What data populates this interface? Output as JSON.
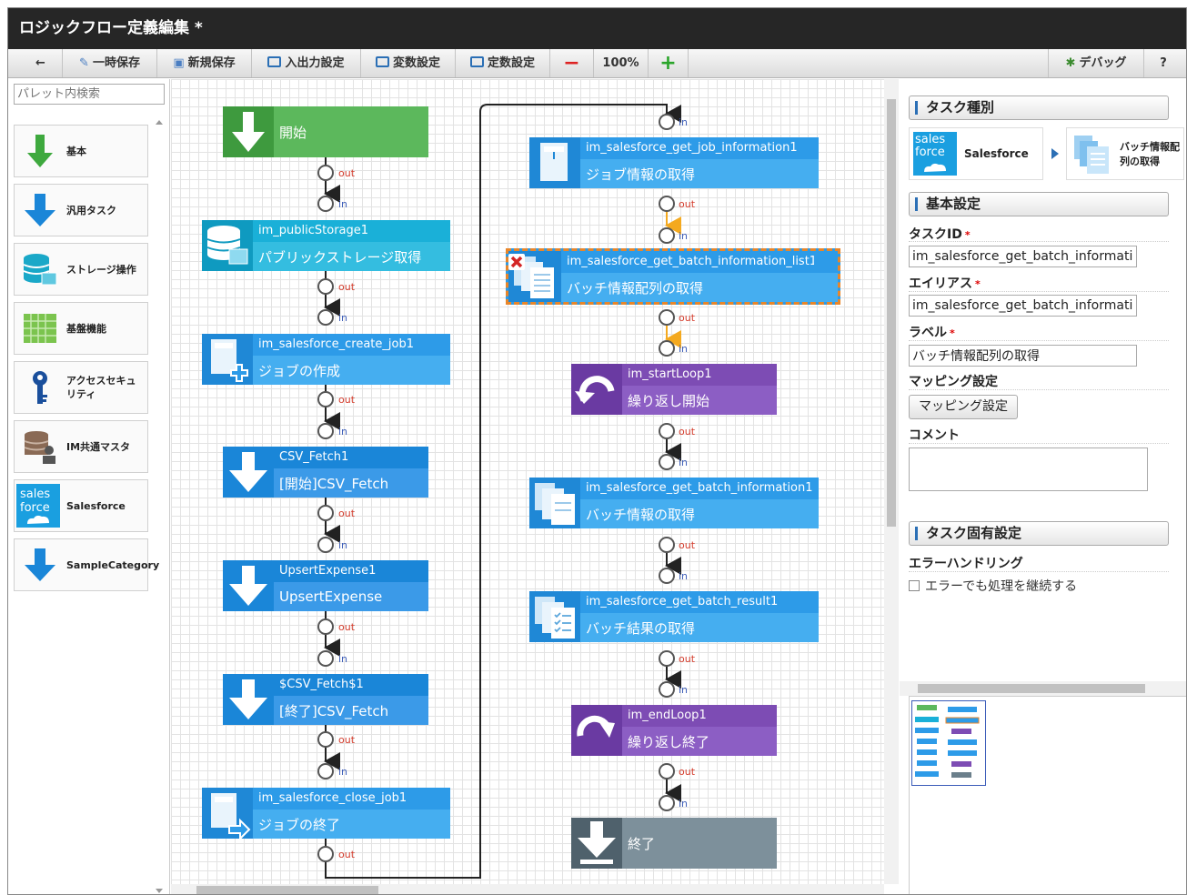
{
  "window": {
    "title": "ロジックフロー定義編集  *"
  },
  "toolbar": {
    "back": "←",
    "temp_save": "一時保存",
    "new_save": "新規保存",
    "io_settings": "入出力設定",
    "var_settings": "変数設定",
    "const_settings": "定数設定",
    "zoom_out": "−",
    "zoom_level": "100%",
    "zoom_in": "+",
    "debug": "デバッグ",
    "help": "?"
  },
  "palette": {
    "search_placeholder": "パレット内検索",
    "items": [
      {
        "label": "基本",
        "icon": "arrow-down-green-icon"
      },
      {
        "label": "汎用タスク",
        "icon": "arrow-down-blue-icon"
      },
      {
        "label": "ストレージ操作",
        "icon": "storage-icon"
      },
      {
        "label": "基盤機能",
        "icon": "platform-grid-icon"
      },
      {
        "label": "アクセスセキュリティ",
        "icon": "key-icon"
      },
      {
        "label": "IM共通マスタ",
        "icon": "master-db-icon"
      },
      {
        "label": "Salesforce",
        "icon": "salesforce-icon"
      },
      {
        "label": "SampleCategory",
        "icon": "arrow-down-blue-icon"
      }
    ]
  },
  "flow": {
    "nodes": [
      {
        "id": "",
        "label": "開始"
      },
      {
        "id": "im_publicStorage1",
        "label": "パブリックストレージ取得"
      },
      {
        "id": "im_salesforce_create_job1",
        "label": "ジョブの作成"
      },
      {
        "id": "CSV_Fetch1",
        "label": "[開始]CSV_Fetch"
      },
      {
        "id": "UpsertExpense1",
        "label": "UpsertExpense"
      },
      {
        "id": "$CSV_Fetch$1",
        "label": "[終了]CSV_Fetch"
      },
      {
        "id": "im_salesforce_close_job1",
        "label": "ジョブの終了"
      },
      {
        "id": "im_salesforce_get_job_information1",
        "label": "ジョブ情報の取得"
      },
      {
        "id": "im_salesforce_get_batch_information_list1",
        "label": "バッチ情報配列の取得"
      },
      {
        "id": "im_startLoop1",
        "label": "繰り返し開始"
      },
      {
        "id": "im_salesforce_get_batch_information1",
        "label": "バッチ情報の取得"
      },
      {
        "id": "im_salesforce_get_batch_result1",
        "label": "バッチ結果の取得"
      },
      {
        "id": "im_endLoop1",
        "label": "繰り返し終了"
      },
      {
        "id": "",
        "label": "終了"
      }
    ],
    "port_in": "in",
    "port_out": "out"
  },
  "properties": {
    "task_type": {
      "header": "タスク種別",
      "category": "Salesforce",
      "category_logo": "sales force",
      "task": "バッチ情報配列の取得"
    },
    "basic": {
      "header": "基本設定",
      "task_id_label": "タスクID",
      "task_id_value": "im_salesforce_get_batch_information",
      "alias_label": "エイリアス",
      "alias_value": "im_salesforce_get_batch_information",
      "label_label": "ラベル",
      "label_value": "バッチ情報配列の取得",
      "required_mark": "*",
      "mapping_label": "マッピング設定",
      "mapping_button": "マッピング設定",
      "comment_label": "コメント",
      "comment_value": ""
    },
    "specific": {
      "header": "タスク固有設定",
      "error_handling_label": "エラーハンドリング",
      "continue_on_error": "エラーでも処理を継続する"
    }
  },
  "colors": {
    "titlebar": "#262626",
    "start_green": "#5cb85c",
    "task_cyan": "#1ab0d8",
    "task_blue": "#2d9be8",
    "loop_purple": "#7d4cb4",
    "end_gray": "#6b7f8b",
    "selected_orange": "#e8862a"
  }
}
